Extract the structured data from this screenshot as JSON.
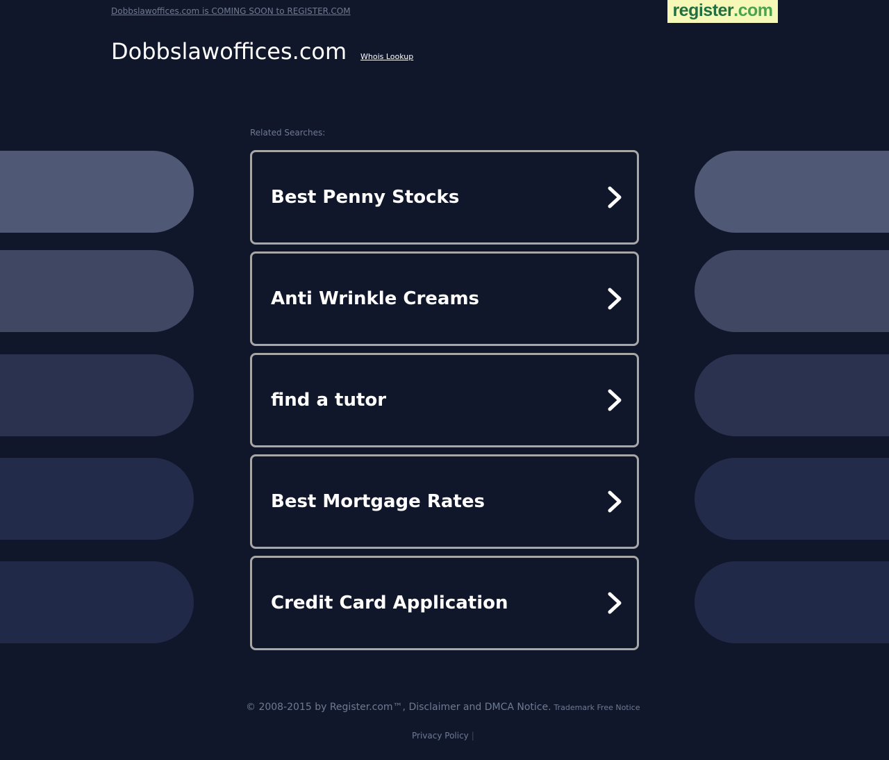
{
  "header": {
    "coming_soon_link": "Dobbslawoffices.com is COMING SOON to REGISTER.COM",
    "logo": {
      "name": "register",
      "tld": ".com"
    },
    "domain_title": "Dobbslawoffices.com",
    "whois_link": "Whois Lookup"
  },
  "related": {
    "label": "Related Searches:",
    "items": [
      {
        "label": "Best Penny Stocks"
      },
      {
        "label": "Anti Wrinkle Creams"
      },
      {
        "label": "find a tutor"
      },
      {
        "label": "Best Mortgage Rates"
      },
      {
        "label": "Credit Card Application"
      }
    ]
  },
  "decor": {
    "pill_colors": [
      "#4f5874",
      "#3f4763",
      "#2a3250",
      "#222b4a",
      "#202a48"
    ]
  },
  "footer": {
    "copyright": "© 2008-2015 by Register.com™, Disclaimer and DMCA Notice.",
    "trademark": "Trademark Free Notice",
    "privacy": "Privacy Policy",
    "separator": "|"
  },
  "colors": {
    "background": "#11172b",
    "muted_text": "#6f7a93",
    "button_border": "#a7a7a7",
    "logo_bg": "#f6f8b7",
    "logo_green_dark": "#1f6f43",
    "logo_green_light": "#4aa34f"
  }
}
